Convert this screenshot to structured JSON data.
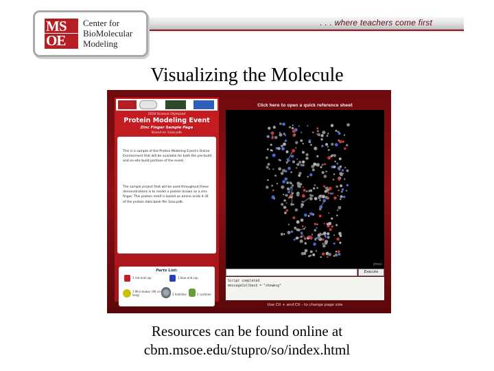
{
  "header": {
    "logo_line1": "Center for",
    "logo_line2": "BioMolecular",
    "logo_line3": "Modeling",
    "logo_mark": "MSOE",
    "tagline": ". . . where teachers come first"
  },
  "title": "Visualizing the Molecule",
  "screenshot": {
    "panel_subtitle": "2010 Science Olympiad",
    "panel_title": "Protein Modeling Event",
    "sample_title": "Zinc Finger Sample Page",
    "based_on": "Based on 1zaa.pdb",
    "desc_para1": "This is a sample of the Protein Modeling Event's Online Environment that will be available for both the pre-build and on-site build portions of the event.",
    "desc_para2": "The sample project that will be used throughout these demonstrations is to model a protein known as a zinc finger. This protein motif is based on amino acids 4-31 of the protein data bank file 1zaa.pdb.",
    "parts_title": "Parts List:",
    "parts": {
      "p1": "1 red end cap",
      "p2": "1 blue end cap",
      "p3": "1 Mini-toober (96 cm long)",
      "p4": "2 histidine",
      "p5": "2 cysteine"
    },
    "reference_link": "Click here to open a quick reference sheet",
    "jmol_label": "Jmol",
    "command_value": "",
    "execute_label": "Execute",
    "console_line1": "Script completed",
    "console_line2": "messageCallback = \"showmsg\"",
    "zoom_hint": "Use Ctl + and Ctl - to change page size",
    "colors": {
      "frame": "#7a0d11",
      "panel": "#c81d22",
      "viewer": "#000000"
    }
  },
  "caption": {
    "line1": "Resources can be found online at",
    "line2": "cbm.msoe.edu/stupro/so/index.html"
  }
}
